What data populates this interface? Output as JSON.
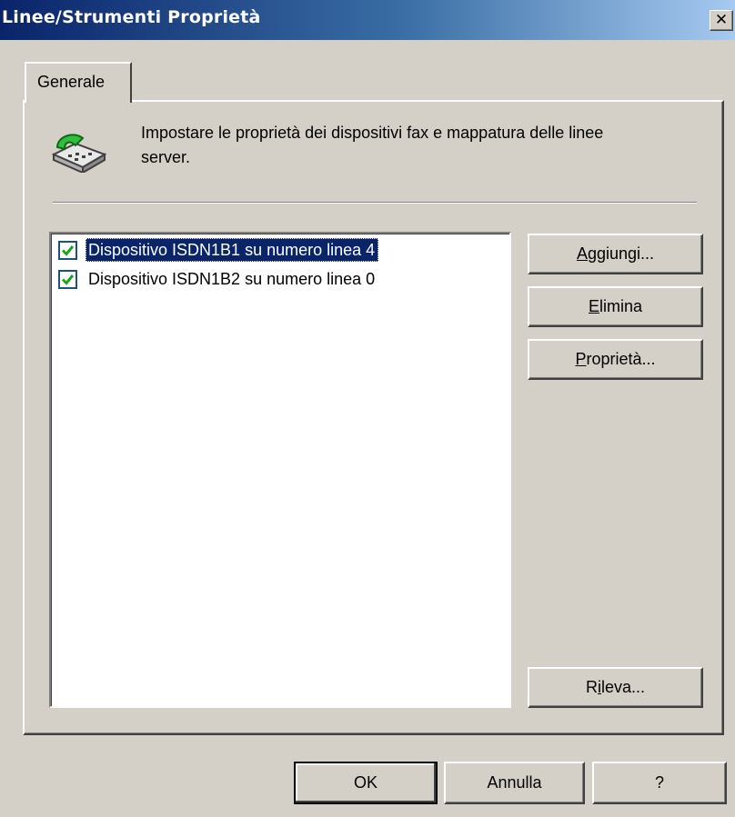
{
  "window": {
    "title": "Linee/Strumenti Proprietà",
    "close_label": "✕"
  },
  "tabs": [
    {
      "label": "Generale",
      "active": true
    }
  ],
  "general": {
    "icon": "fax-icon",
    "description_line1": "Impostare le proprietà dei dispositivi fax e mappatura delle linee",
    "description_line2": "server."
  },
  "devices": [
    {
      "label": "Dispositivo ISDN1B1 su numero linea 4",
      "checked": true,
      "selected": true
    },
    {
      "label": "Dispositivo ISDN1B2 su numero linea 0",
      "checked": true,
      "selected": false
    }
  ],
  "buttons": {
    "add": {
      "pre": "",
      "mnemonic": "A",
      "post": "ggiungi..."
    },
    "delete": {
      "pre": "",
      "mnemonic": "E",
      "post": "limina"
    },
    "properties": {
      "pre": "",
      "mnemonic": "P",
      "post": "roprietà..."
    },
    "detect": {
      "pre": "R",
      "mnemonic": "i",
      "post": "leva..."
    },
    "ok": "OK",
    "cancel": "Annulla",
    "help": "?"
  },
  "colors": {
    "dialog_bg": "#d4d0c8",
    "titlebar_start": "#0a246a",
    "titlebar_end": "#a6caf0",
    "selection_bg": "#0a246a",
    "checkmark": "#21a121"
  }
}
